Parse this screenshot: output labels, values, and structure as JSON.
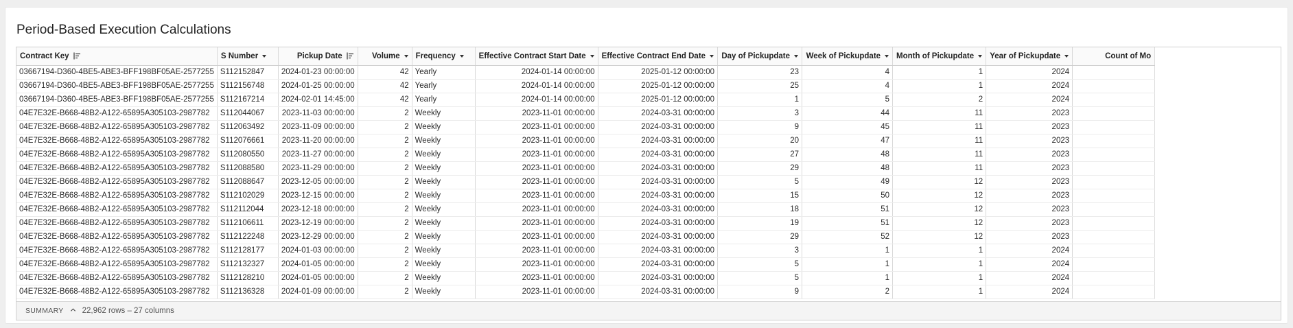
{
  "title": "Period-Based Execution Calculations",
  "columns": [
    {
      "label": "Contract Key",
      "align": "l",
      "icon": "sort-icon"
    },
    {
      "label": "S Number",
      "align": "l",
      "icon": "chevron-down-icon"
    },
    {
      "label": "Pickup Date",
      "align": "r",
      "icon": "sort-icon"
    },
    {
      "label": "Volume",
      "align": "r",
      "icon": "chevron-down-icon"
    },
    {
      "label": "Frequency",
      "align": "l",
      "icon": "chevron-down-icon"
    },
    {
      "label": "Effective Contract Start Date",
      "align": "r",
      "icon": "chevron-down-icon"
    },
    {
      "label": "Effective Contract End Date",
      "align": "r",
      "icon": "chevron-down-icon"
    },
    {
      "label": "Day of Pickupdate",
      "align": "r",
      "icon": "chevron-down-icon"
    },
    {
      "label": "Week of Pickupdate",
      "align": "r",
      "icon": "chevron-down-icon"
    },
    {
      "label": "Month of Pickupdate",
      "align": "r",
      "icon": "chevron-down-icon"
    },
    {
      "label": "Year of Pickupdate",
      "align": "r",
      "icon": "chevron-down-icon"
    },
    {
      "label": "Count of Mo",
      "align": "r",
      "icon": ""
    }
  ],
  "rows": [
    [
      "03667194-D360-4BE5-ABE3-BFF198BF05AE-2577255",
      "S112152847",
      "2024-01-23 00:00:00",
      "42",
      "Yearly",
      "2024-01-14 00:00:00",
      "2025-01-12 00:00:00",
      "23",
      "4",
      "1",
      "2024",
      ""
    ],
    [
      "03667194-D360-4BE5-ABE3-BFF198BF05AE-2577255",
      "S112156748",
      "2024-01-25 00:00:00",
      "42",
      "Yearly",
      "2024-01-14 00:00:00",
      "2025-01-12 00:00:00",
      "25",
      "4",
      "1",
      "2024",
      ""
    ],
    [
      "03667194-D360-4BE5-ABE3-BFF198BF05AE-2577255",
      "S112167214",
      "2024-02-01 14:45:00",
      "42",
      "Yearly",
      "2024-01-14 00:00:00",
      "2025-01-12 00:00:00",
      "1",
      "5",
      "2",
      "2024",
      ""
    ],
    [
      "04E7E32E-B668-48B2-A122-65895A305103-2987782",
      "S112044067",
      "2023-11-03 00:00:00",
      "2",
      "Weekly",
      "2023-11-01 00:00:00",
      "2024-03-31 00:00:00",
      "3",
      "44",
      "11",
      "2023",
      ""
    ],
    [
      "04E7E32E-B668-48B2-A122-65895A305103-2987782",
      "S112063492",
      "2023-11-09 00:00:00",
      "2",
      "Weekly",
      "2023-11-01 00:00:00",
      "2024-03-31 00:00:00",
      "9",
      "45",
      "11",
      "2023",
      ""
    ],
    [
      "04E7E32E-B668-48B2-A122-65895A305103-2987782",
      "S112076661",
      "2023-11-20 00:00:00",
      "2",
      "Weekly",
      "2023-11-01 00:00:00",
      "2024-03-31 00:00:00",
      "20",
      "47",
      "11",
      "2023",
      ""
    ],
    [
      "04E7E32E-B668-48B2-A122-65895A305103-2987782",
      "S112080550",
      "2023-11-27 00:00:00",
      "2",
      "Weekly",
      "2023-11-01 00:00:00",
      "2024-03-31 00:00:00",
      "27",
      "48",
      "11",
      "2023",
      ""
    ],
    [
      "04E7E32E-B668-48B2-A122-65895A305103-2987782",
      "S112088580",
      "2023-11-29 00:00:00",
      "2",
      "Weekly",
      "2023-11-01 00:00:00",
      "2024-03-31 00:00:00",
      "29",
      "48",
      "11",
      "2023",
      ""
    ],
    [
      "04E7E32E-B668-48B2-A122-65895A305103-2987782",
      "S112088647",
      "2023-12-05 00:00:00",
      "2",
      "Weekly",
      "2023-11-01 00:00:00",
      "2024-03-31 00:00:00",
      "5",
      "49",
      "12",
      "2023",
      ""
    ],
    [
      "04E7E32E-B668-48B2-A122-65895A305103-2987782",
      "S112102029",
      "2023-12-15 00:00:00",
      "2",
      "Weekly",
      "2023-11-01 00:00:00",
      "2024-03-31 00:00:00",
      "15",
      "50",
      "12",
      "2023",
      ""
    ],
    [
      "04E7E32E-B668-48B2-A122-65895A305103-2987782",
      "S112112044",
      "2023-12-18 00:00:00",
      "2",
      "Weekly",
      "2023-11-01 00:00:00",
      "2024-03-31 00:00:00",
      "18",
      "51",
      "12",
      "2023",
      ""
    ],
    [
      "04E7E32E-B668-48B2-A122-65895A305103-2987782",
      "S112106611",
      "2023-12-19 00:00:00",
      "2",
      "Weekly",
      "2023-11-01 00:00:00",
      "2024-03-31 00:00:00",
      "19",
      "51",
      "12",
      "2023",
      ""
    ],
    [
      "04E7E32E-B668-48B2-A122-65895A305103-2987782",
      "S112122248",
      "2023-12-29 00:00:00",
      "2",
      "Weekly",
      "2023-11-01 00:00:00",
      "2024-03-31 00:00:00",
      "29",
      "52",
      "12",
      "2023",
      ""
    ],
    [
      "04E7E32E-B668-48B2-A122-65895A305103-2987782",
      "S112128177",
      "2024-01-03 00:00:00",
      "2",
      "Weekly",
      "2023-11-01 00:00:00",
      "2024-03-31 00:00:00",
      "3",
      "1",
      "1",
      "2024",
      ""
    ],
    [
      "04E7E32E-B668-48B2-A122-65895A305103-2987782",
      "S112132327",
      "2024-01-05 00:00:00",
      "2",
      "Weekly",
      "2023-11-01 00:00:00",
      "2024-03-31 00:00:00",
      "5",
      "1",
      "1",
      "2024",
      ""
    ],
    [
      "04E7E32E-B668-48B2-A122-65895A305103-2987782",
      "S112128210",
      "2024-01-05 00:00:00",
      "2",
      "Weekly",
      "2023-11-01 00:00:00",
      "2024-03-31 00:00:00",
      "5",
      "1",
      "1",
      "2024",
      ""
    ],
    [
      "04E7E32E-B668-48B2-A122-65895A305103-2987782",
      "S112136328",
      "2024-01-09 00:00:00",
      "2",
      "Weekly",
      "2023-11-01 00:00:00",
      "2024-03-31 00:00:00",
      "9",
      "2",
      "1",
      "2024",
      ""
    ]
  ],
  "summary": {
    "label": "SUMMARY",
    "stats": "22,962 rows – 27 columns"
  }
}
